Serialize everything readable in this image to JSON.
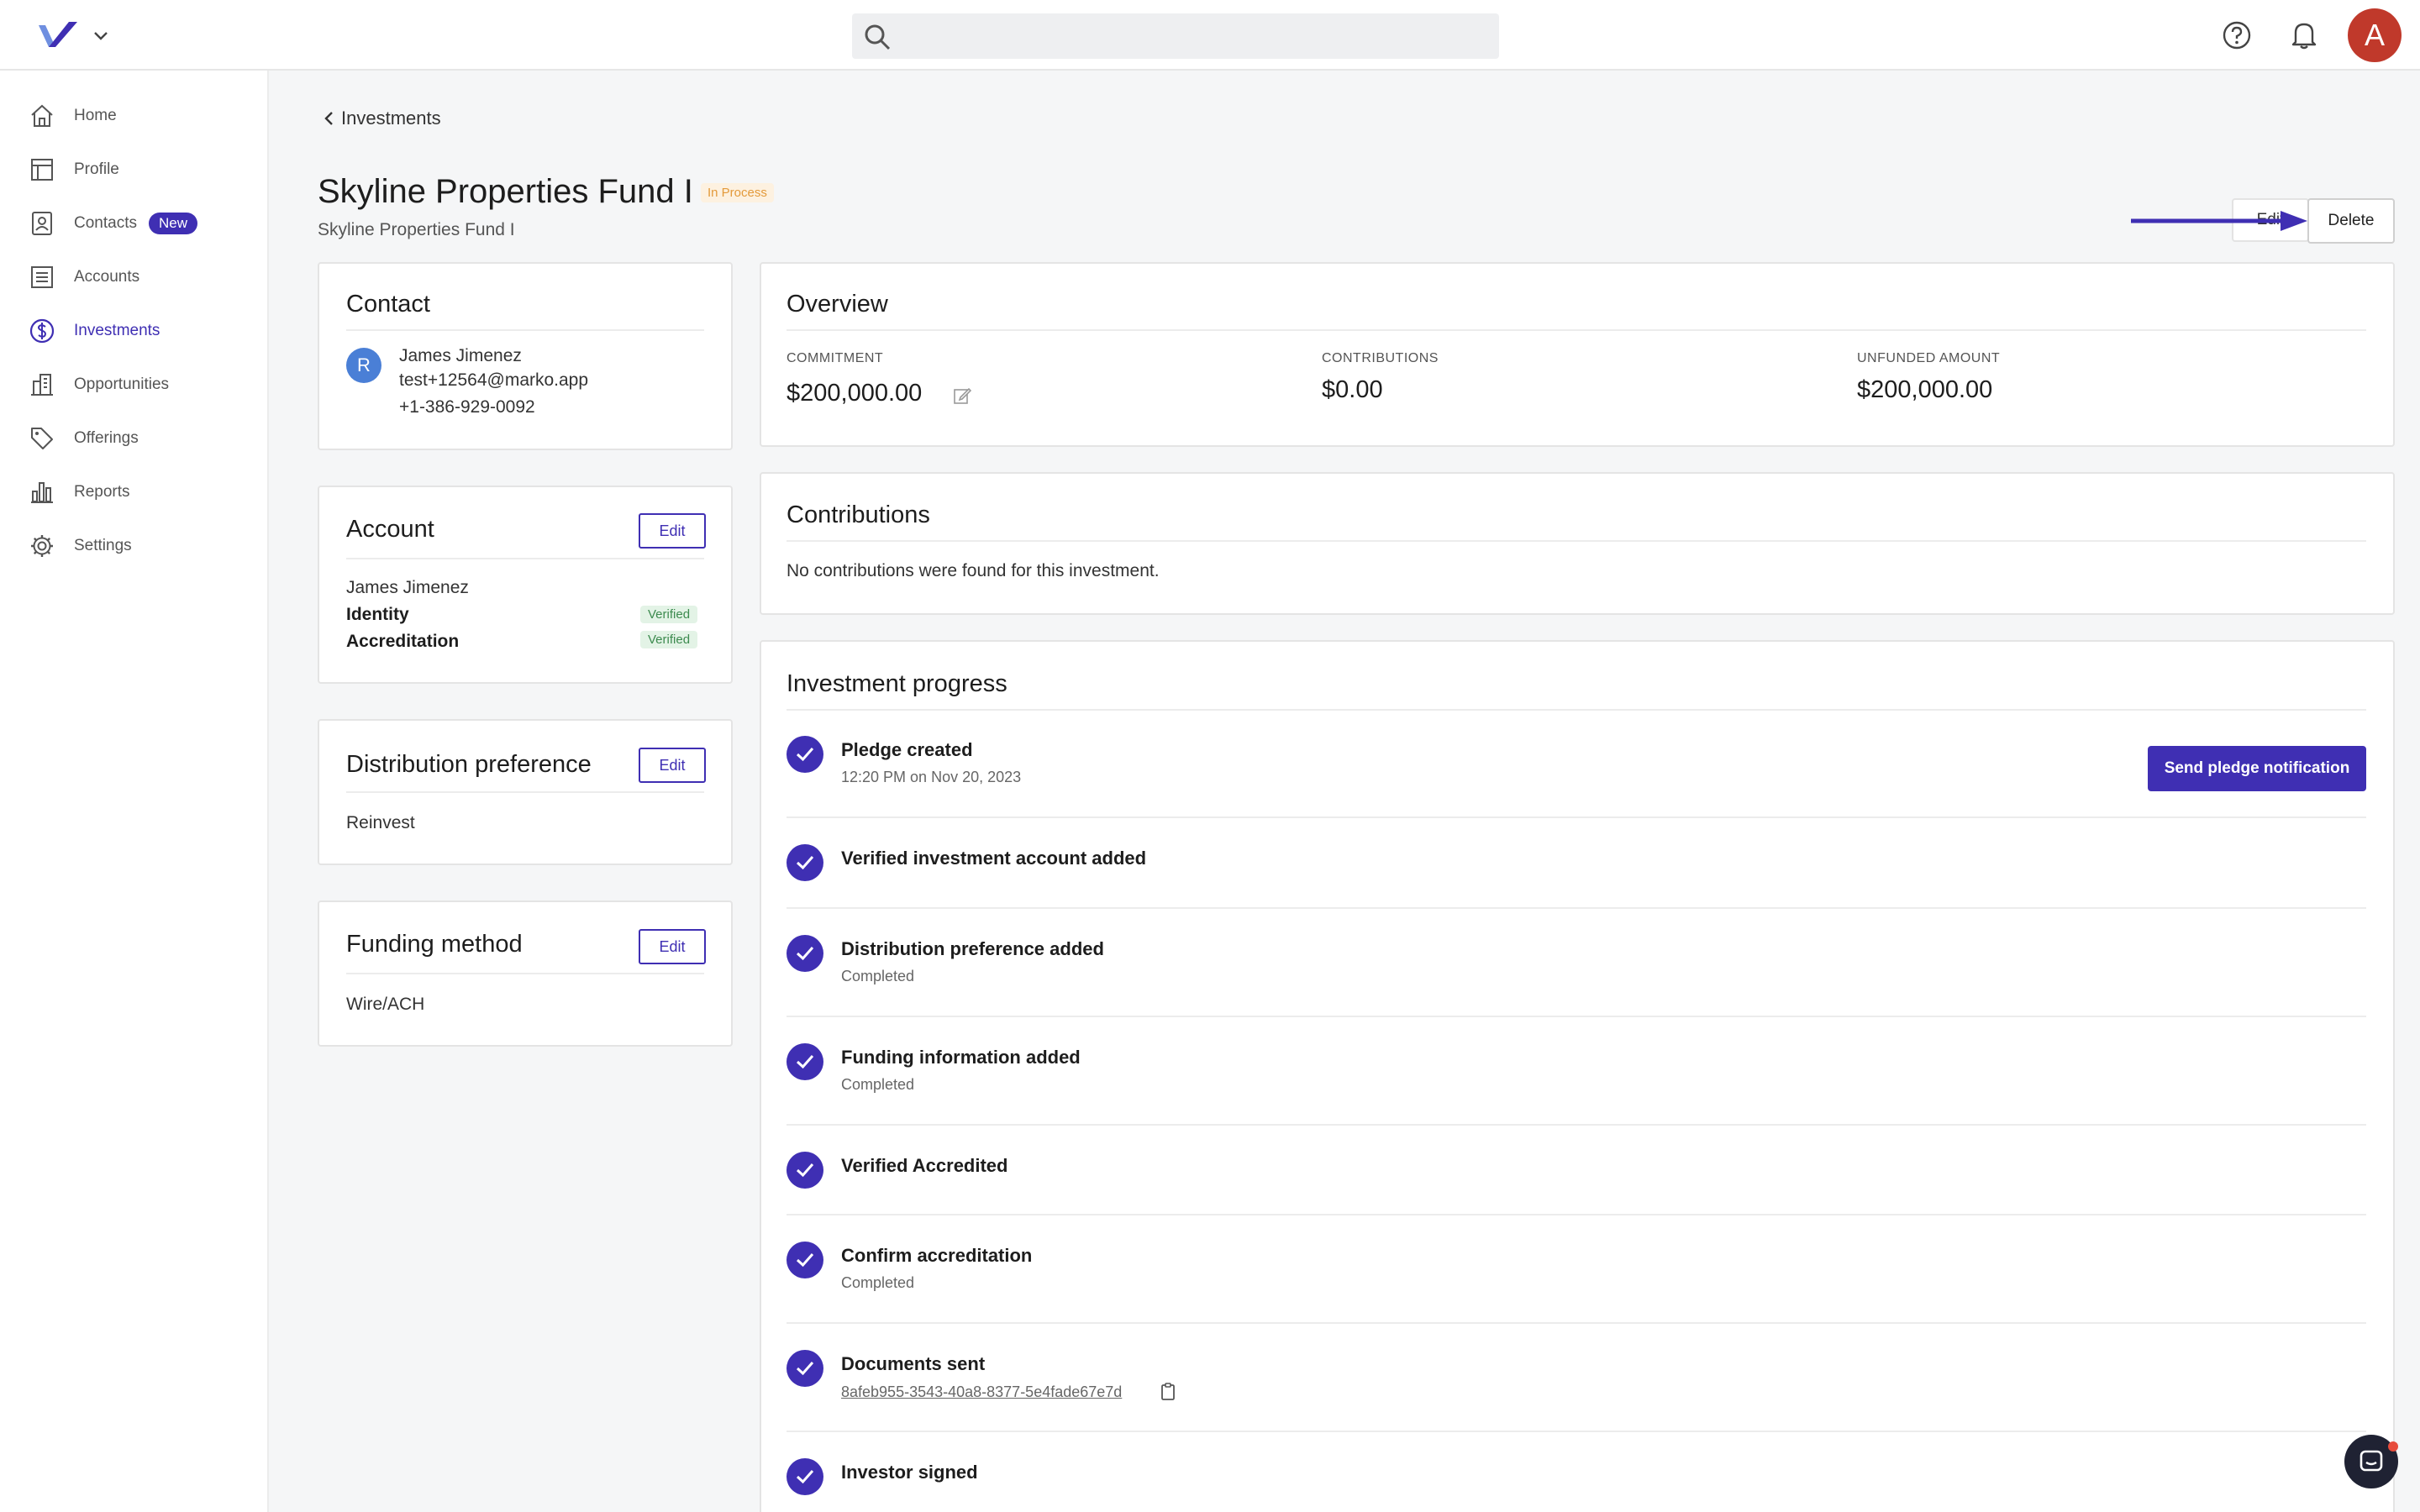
{
  "app": {
    "brand_icon": "v-logo-icon",
    "user_initial": "A",
    "accent": "#3f2fb3"
  },
  "sidebar": {
    "items": [
      {
        "label": "Home",
        "icon": "home-icon"
      },
      {
        "label": "Profile",
        "icon": "profile-icon"
      },
      {
        "label": "Contacts",
        "icon": "contacts-icon",
        "badge": "New"
      },
      {
        "label": "Accounts",
        "icon": "accounts-icon"
      },
      {
        "label": "Investments",
        "icon": "dollar-icon",
        "active": true
      },
      {
        "label": "Opportunities",
        "icon": "building-icon"
      },
      {
        "label": "Offerings",
        "icon": "tag-icon"
      },
      {
        "label": "Reports",
        "icon": "bar-chart-icon"
      },
      {
        "label": "Settings",
        "icon": "gear-icon"
      }
    ]
  },
  "header": {
    "breadcrumb": "Investments",
    "title": "Skyline Properties Fund I",
    "status": "In Process",
    "subtitle": "Skyline Properties Fund I",
    "edit_label": "Edit",
    "delete_label": "Delete"
  },
  "contact": {
    "title": "Contact",
    "initial": "R",
    "name": "James Jimenez",
    "email": "test+12564@marko.app",
    "phone": "+1-386-929-0092"
  },
  "account": {
    "title": "Account",
    "edit_label": "Edit",
    "name": "James Jimenez",
    "identity_label": "Identity",
    "identity_status": "Verified",
    "accreditation_label": "Accreditation",
    "accreditation_status": "Verified"
  },
  "distribution": {
    "title": "Distribution preference",
    "edit_label": "Edit",
    "value": "Reinvest"
  },
  "funding": {
    "title": "Funding method",
    "edit_label": "Edit",
    "value": "Wire/ACH"
  },
  "overview": {
    "title": "Overview",
    "commitment_label": "COMMITMENT",
    "commitment_value": "$200,000.00",
    "contributions_label": "CONTRIBUTIONS",
    "contributions_value": "$0.00",
    "unfunded_label": "UNFUNDED AMOUNT",
    "unfunded_value": "$200,000.00"
  },
  "contributions": {
    "title": "Contributions",
    "empty_text": "No contributions were found for this investment."
  },
  "progress": {
    "title": "Investment progress",
    "send_button": "Send pledge notification",
    "steps": [
      {
        "title": "Pledge created",
        "sub": "12:20 PM on Nov 20, 2023"
      },
      {
        "title": "Verified investment account added",
        "sub": ""
      },
      {
        "title": "Distribution preference added",
        "sub": "Completed"
      },
      {
        "title": "Funding information added",
        "sub": "Completed"
      },
      {
        "title": "Verified Accredited",
        "sub": ""
      },
      {
        "title": "Confirm accreditation",
        "sub": "Completed"
      },
      {
        "title": "Documents sent",
        "sub": "8afeb955-3543-40a8-8377-5e4fade67e7d"
      },
      {
        "title": "Investor signed",
        "sub": ""
      }
    ]
  }
}
